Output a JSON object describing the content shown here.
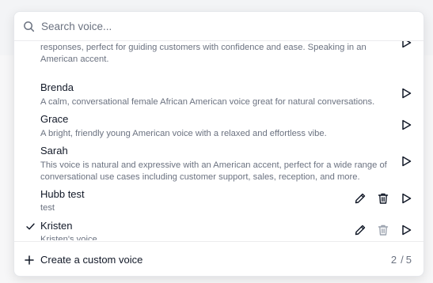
{
  "search": {
    "placeholder": "Search voice..."
  },
  "voices": [
    {
      "name": "",
      "description": "responses, perfect for guiding customers with confidence and ease. Speaking in an American accent."
    },
    {
      "name": "Brenda",
      "description": "A calm, conversational female African American voice great for natural conversations."
    },
    {
      "name": "Grace",
      "description": "A bright, friendly young American voice with a relaxed and effortless vibe."
    },
    {
      "name": "Sarah",
      "description": "This voice is natural and expressive with an American accent, perfect for a wide range of conversational use cases including customer support, sales, reception, and more."
    },
    {
      "name": "Hubb test",
      "description": "test"
    },
    {
      "name": "Kristen",
      "description": "Kristen's voice",
      "selected": true
    }
  ],
  "footer": {
    "create_label": "Create a custom voice",
    "count_current": "2",
    "count_sep": "/",
    "count_total": "5"
  },
  "colors": {
    "icon": "#111827",
    "icon_disabled": "#9ca3af",
    "muted_text": "#6b7280"
  }
}
